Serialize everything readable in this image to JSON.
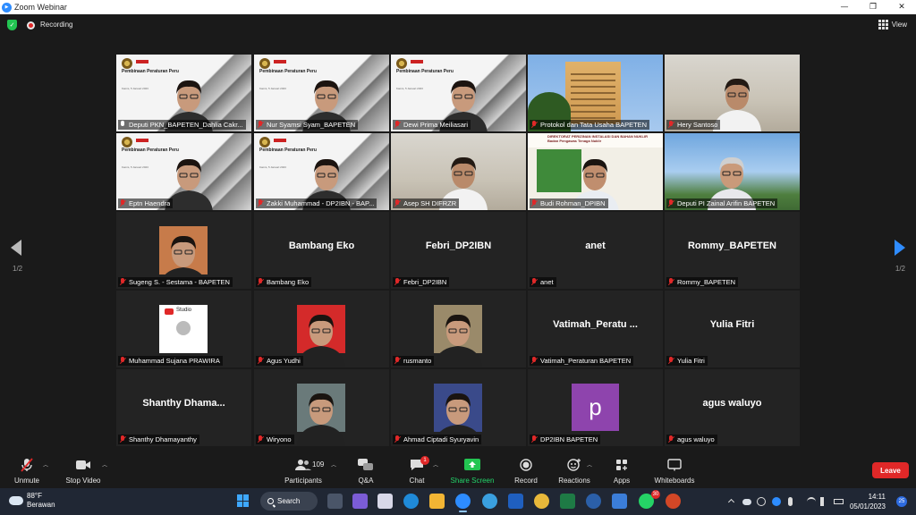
{
  "window": {
    "title": "Zoom Webinar",
    "controls": {
      "minimize": "—",
      "maximize": "❐",
      "close": "✕"
    }
  },
  "topbar": {
    "recording_label": "Recording",
    "view_label": "View",
    "security_icon": "shield-check-icon"
  },
  "pagination": {
    "left": "1/2",
    "right": "1/2"
  },
  "tiles": [
    {
      "name": "Deputi PKN_BAPETEN_Dahlia Cakr...",
      "kind": "slides-person",
      "muted": false,
      "active": true,
      "slide_title": "Pembinaan Peraturan Perundang-undangan Ketenaganukliran",
      "slide_date": "Kamis, 5 Januari 2023"
    },
    {
      "name": "Nur Syamsi Syam_BAPETEN",
      "kind": "slides-person",
      "muted": true,
      "slide_title": "Pembinaan Peraturan Perundang-undangan Ketenaganukliran",
      "slide_date": "Kamis, 5 Januari 2023"
    },
    {
      "name": "Dewi Prima Meiliasari",
      "kind": "slides-person",
      "muted": true,
      "slide_title": "Pembinaan Peraturan Perundang-undangan Ketenaganukliran",
      "slide_date": "Kamis, 5 Januari 2023"
    },
    {
      "name": "Protokol dan Tata Usaha BAPETEN",
      "kind": "building",
      "muted": true
    },
    {
      "name": "Hery Santoso",
      "kind": "room-person",
      "muted": true
    },
    {
      "name": "Eptn Haendra",
      "kind": "slides-person",
      "muted": true,
      "slide_title": "Pembinaan Peraturan Perundang-undangan Ketenaganukliran",
      "slide_date": "Kamis, 5 Januari 2023"
    },
    {
      "name": "Zakki Muhammad - DP2IBN - BAP...",
      "kind": "slides-person",
      "muted": true,
      "slide_title": "Pembinaan Peraturan Perundang-undangan Ketenaganukliran",
      "slide_date": "Kamis, 5 Januari 2023"
    },
    {
      "name": "Asep SH DIFRZR",
      "kind": "room-person",
      "muted": true
    },
    {
      "name": "Budi Rohman_DPIBN",
      "kind": "banner-person",
      "muted": true,
      "banner_title": "DIREKTORAT PERIZINAN INSTALASI DAN BAHAN NUKLIR",
      "banner_subtitle": "Badan Pengawas Tenaga Nuklir"
    },
    {
      "name": "Deputi PI Zainal Arifin BAPETEN",
      "kind": "sky-person",
      "muted": true
    },
    {
      "name": "Sugeng S. - Sestama - BAPETEN",
      "kind": "avatar",
      "muted": true,
      "avatar_color": "#c77b4a"
    },
    {
      "name": "Bambang Eko",
      "kind": "name",
      "display": "Bambang Eko",
      "muted": true
    },
    {
      "name": "Febri_DP2IBN",
      "kind": "name",
      "display": "Febri_DP2IBN",
      "muted": true
    },
    {
      "name": "anet",
      "kind": "name",
      "display": "anet",
      "muted": true
    },
    {
      "name": "Rommy_BAPETEN",
      "kind": "name",
      "display": "Rommy_BAPETEN",
      "muted": true
    },
    {
      "name": "Muhammad Sujana PRAWIRA",
      "kind": "avatar-studio",
      "muted": true,
      "avatar_text": "Studio"
    },
    {
      "name": "Agus Yudhi",
      "kind": "avatar",
      "muted": true,
      "avatar_color": "#d42a2a"
    },
    {
      "name": "rusmanto",
      "kind": "avatar",
      "muted": true,
      "avatar_color": "#9a8a6a"
    },
    {
      "name": "Vatimah_Peraturan BAPETEN",
      "kind": "name",
      "display": "Vatimah_Peratu ...",
      "muted": true
    },
    {
      "name": "Yulia Fitri",
      "kind": "name",
      "display": "Yulia Fitri",
      "muted": true
    },
    {
      "name": "Shanthy Dhamayanthy",
      "kind": "name",
      "display": "Shanthy  Dhama...",
      "muted": true
    },
    {
      "name": "Wiryono",
      "kind": "avatar",
      "muted": true,
      "avatar_color": "#6a7a7a"
    },
    {
      "name": "Ahmad Ciptadi Syuryavin",
      "kind": "avatar",
      "muted": true,
      "avatar_color": "#3a4a8a"
    },
    {
      "name": "DP2IBN BAPETEN",
      "kind": "letter",
      "letter": "p",
      "muted": true
    },
    {
      "name": "agus waluyo",
      "kind": "name",
      "display": "agus waluyo",
      "muted": true
    }
  ],
  "toolbar": {
    "unmute": "Unmute",
    "stop_video": "Stop Video",
    "participants": "Participants",
    "participants_count": "109",
    "qa": "Q&A",
    "chat": "Chat",
    "chat_badge": "1",
    "share_screen": "Share Screen",
    "record": "Record",
    "reactions": "Reactions",
    "apps": "Apps",
    "whiteboards": "Whiteboards",
    "leave": "Leave"
  },
  "taskbar": {
    "temperature": "88°F",
    "weather": "Berawan",
    "search_label": "Search",
    "time": "14:11",
    "date": "05/01/2023",
    "notification_count": "25",
    "whatsapp_badge": "30"
  },
  "colors": {
    "background": "#1a1a1a",
    "tile": "#232323",
    "active_border": "#d6e24a",
    "leave": "#e02828",
    "share": "#23d36a",
    "accent": "#2f8cff"
  }
}
